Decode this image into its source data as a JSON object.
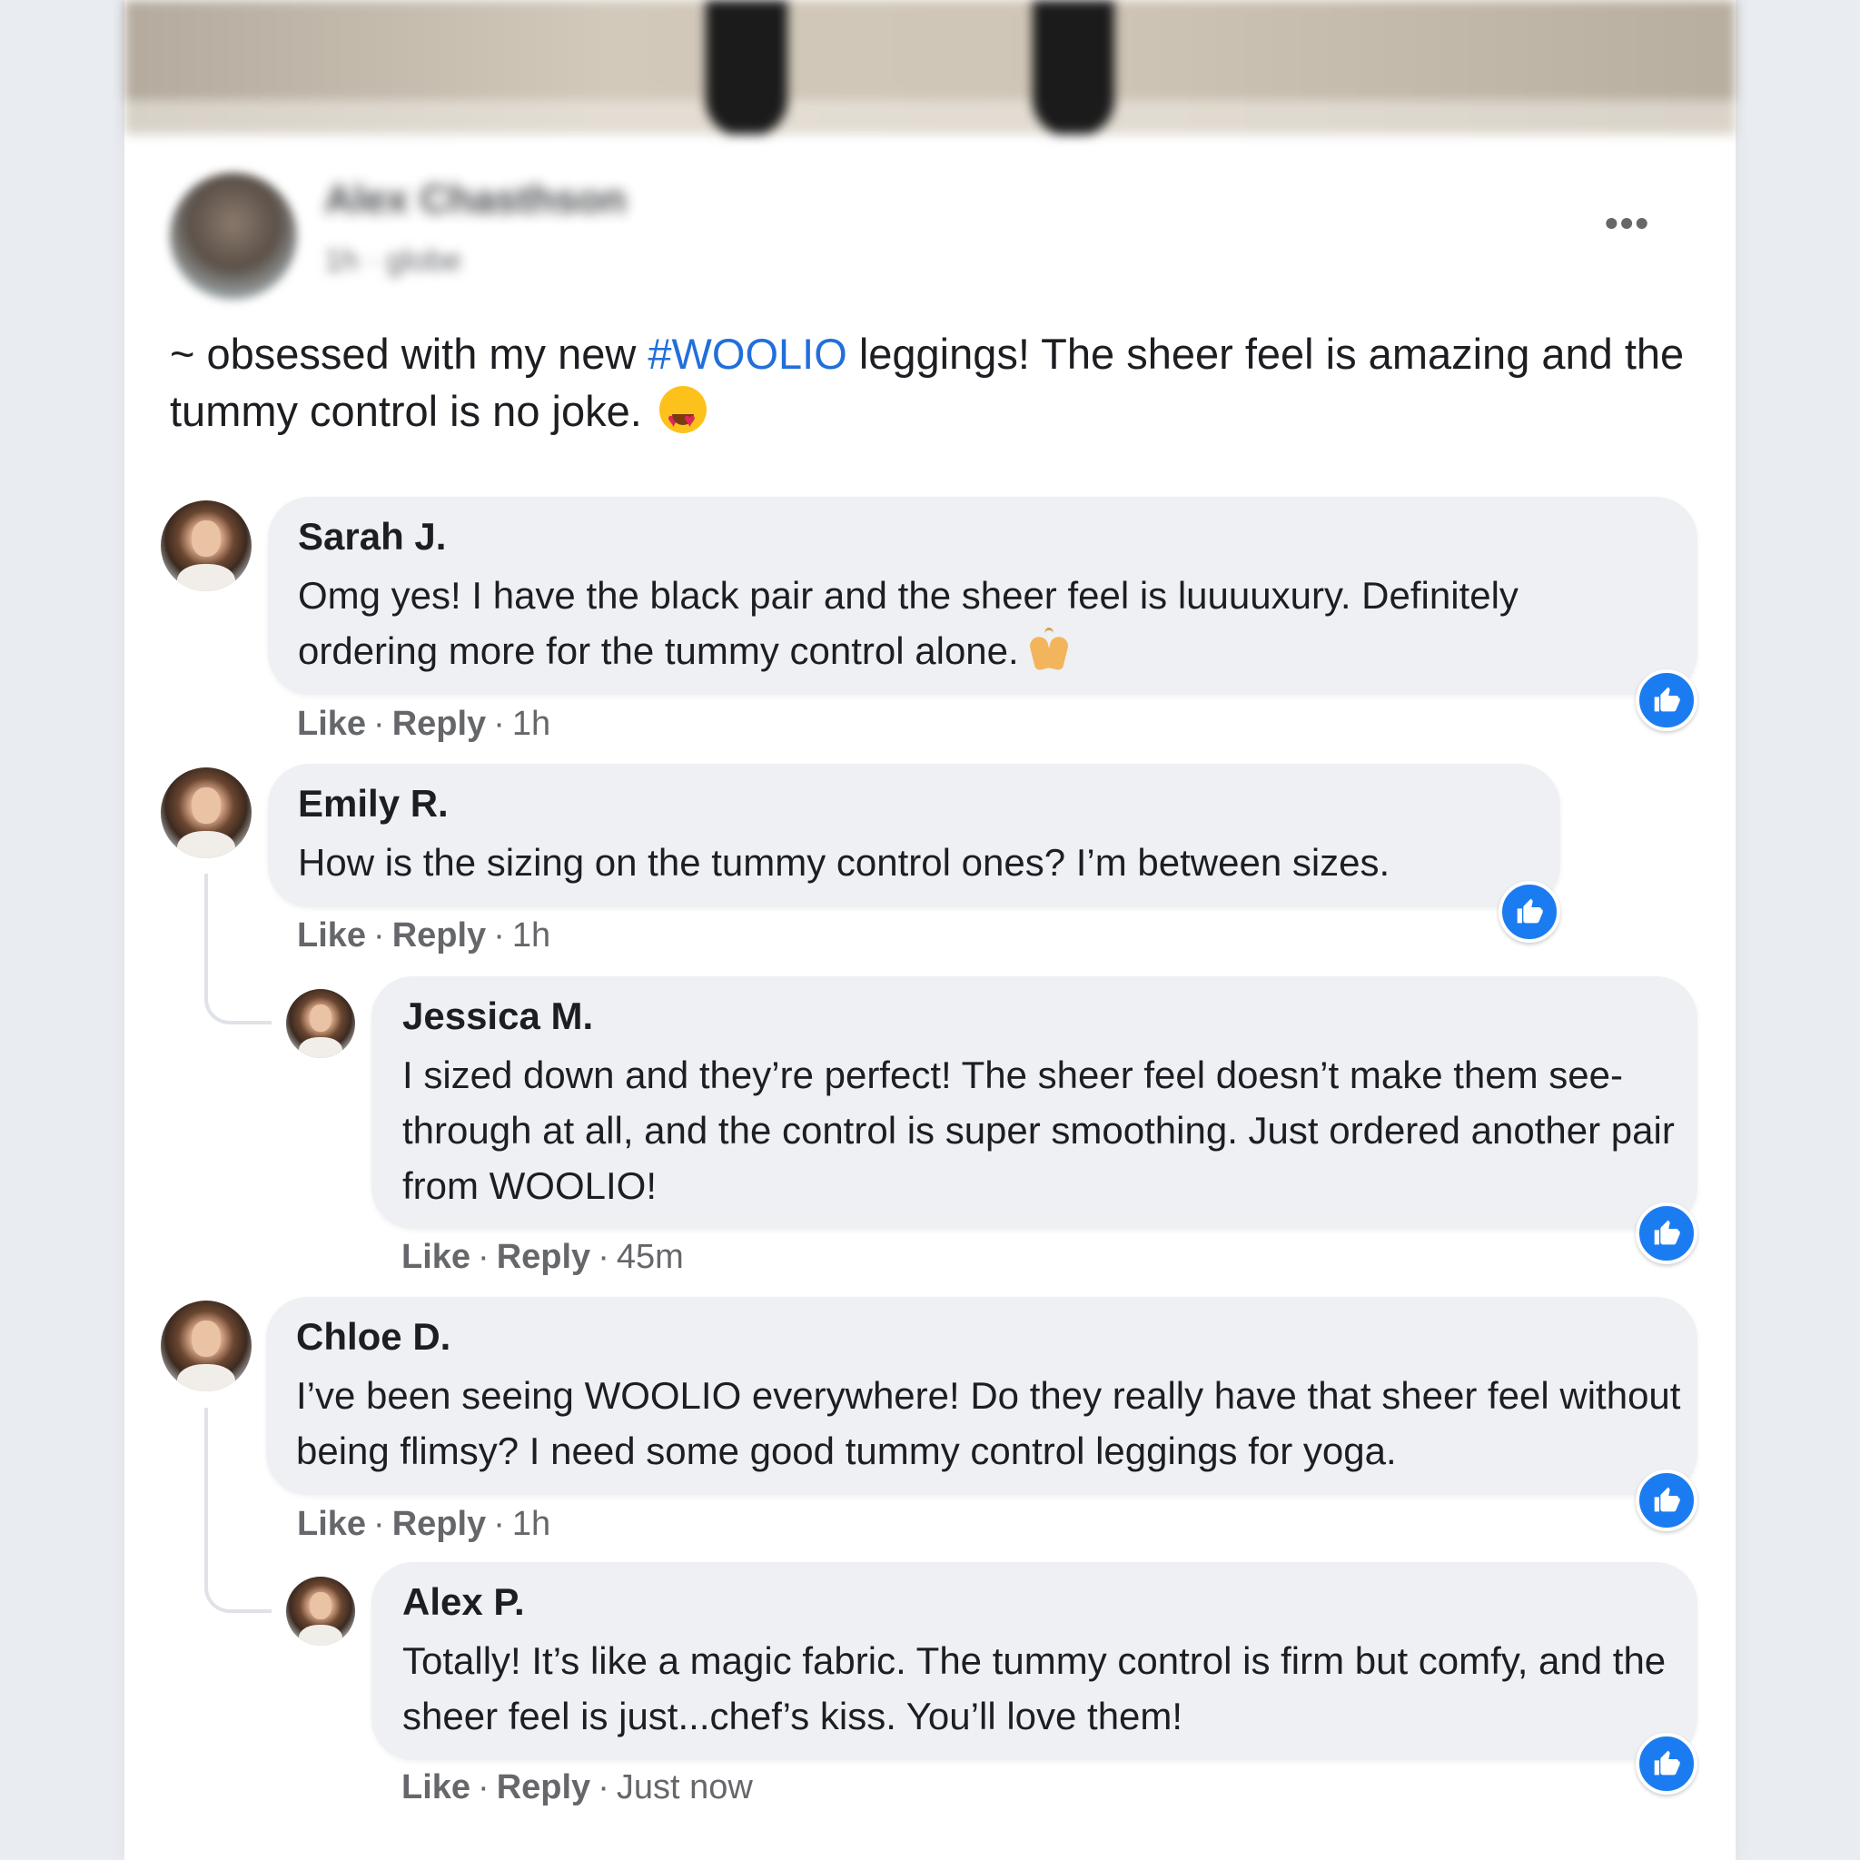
{
  "post": {
    "author": "Alex Chasthson",
    "meta": "1h · globe",
    "text_prefix": "~ obsessed with my new ",
    "hashtag": "#WOOLIO",
    "text_suffix": " leggings! The sheer feel is amazing and the tummy control is no joke.",
    "more_label": "•••"
  },
  "actions": {
    "like": "Like",
    "reply": "Reply",
    "dot": "·"
  },
  "comments": [
    {
      "name": "Sarah J.",
      "text": "Omg yes! I have the black pair and the sheer feel is luuuuxury. Definitely ordering more for the tummy control alone.",
      "time": "1h"
    },
    {
      "name": "Emily R.",
      "text": "How is the sizing on the tummy control ones? I’m between sizes.",
      "time": "1h"
    },
    {
      "name": "Jessica M.",
      "text": "I sized down and they’re perfect! The sheer feel doesn’t make them see-through at all, and the control is super smoothing. Just ordered another pair from WOOLIO!",
      "time": "45m"
    },
    {
      "name": "Chloe D.",
      "text": "I’ve been seeing WOOLIO everywhere! Do they really have that sheer feel without being flimsy? I need some good tummy control leggings for yoga.",
      "time": "1h"
    },
    {
      "name": "Alex P.",
      "text": "Totally! It’s like a magic fabric. The tummy control is firm but comfy, and the sheer feel is just...chef’s kiss. You’ll love them!",
      "time": "Just now"
    }
  ],
  "colors": {
    "hashtag": "#216fdb",
    "like_badge": "#1a7cf0",
    "bubble": "#eef0f3",
    "secondary_text": "#65676b"
  }
}
